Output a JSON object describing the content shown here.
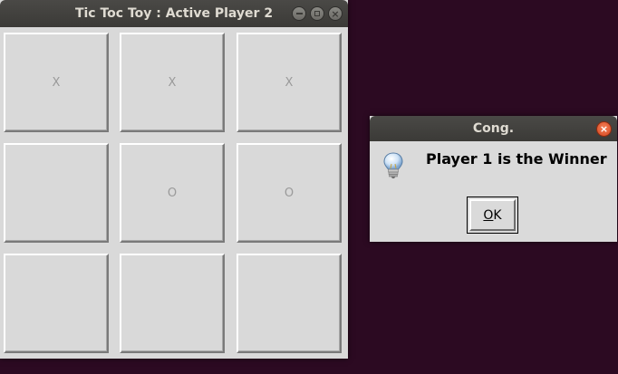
{
  "main_window": {
    "title": "Tic Toc Toy : Active Player 2",
    "controls": [
      "minimize-icon",
      "maximize-icon",
      "close-icon"
    ]
  },
  "board": {
    "cells": [
      "X",
      "X",
      "X",
      "",
      "O",
      "O",
      "",
      "",
      ""
    ]
  },
  "dialog": {
    "title": "Cong.",
    "message": "Player 1 is the Winner",
    "icon": "lightbulb-icon",
    "ok_mnemonic": "O",
    "ok_rest": "K"
  },
  "colors": {
    "desktop": "#2c0a22",
    "titlebar": "#3c3b37",
    "close_button": "#e05a2b",
    "window_bg": "#d9d9d9"
  }
}
